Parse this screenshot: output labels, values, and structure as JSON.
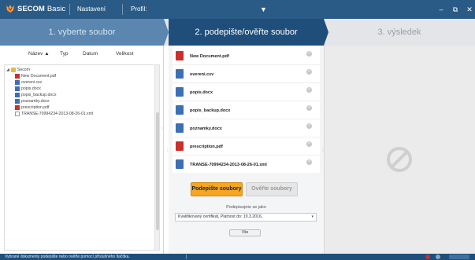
{
  "app": {
    "brand": "SECOM",
    "edition": "Basic",
    "menu": [
      "Nastavení",
      "Profil:"
    ],
    "window_buttons": [
      "–",
      "⧉",
      "✕"
    ]
  },
  "colors": {
    "titlebar": "#2a5b86",
    "step_inactive": "#5a86b0",
    "step_active": "#1f4e7b",
    "sign_button": "#f5a623"
  },
  "steps": [
    {
      "label": "1. vyberte soubor",
      "state": "done"
    },
    {
      "label": "2. podepište/ověřte soubor",
      "state": "active"
    },
    {
      "label": "3. výsledek",
      "state": "pending"
    }
  ],
  "browser": {
    "columns": [
      "Název ▲",
      "Typ",
      "Datum",
      "Velikost"
    ],
    "tree": [
      {
        "label": "Secom",
        "type": "folder",
        "depth": 0,
        "expanded": true
      },
      {
        "label": "New Document.pdf",
        "type": "pdf",
        "depth": 1
      },
      {
        "label": "overeni.csv",
        "type": "doc",
        "depth": 1
      },
      {
        "label": "popis.docx",
        "type": "doc",
        "depth": 1
      },
      {
        "label": "popis_backup.docx",
        "type": "doc",
        "depth": 1
      },
      {
        "label": "poznamky.docx",
        "type": "doc",
        "depth": 1
      },
      {
        "label": "prescription.pdf",
        "type": "pdf",
        "depth": 1
      },
      {
        "label": "TRANSE-70994234-2013-08-26-01.xml",
        "type": "xml",
        "depth": 1
      }
    ]
  },
  "selected_files": [
    {
      "name": "New Document.pdf",
      "type": "pdf"
    },
    {
      "name": "overeni.csv",
      "type": "doc"
    },
    {
      "name": "popis.docx",
      "type": "doc"
    },
    {
      "name": "popis_backup.docx",
      "type": "doc"
    },
    {
      "name": "poznamky.docx",
      "type": "doc"
    },
    {
      "name": "prescription.pdf",
      "type": "pdf"
    },
    {
      "name": "TRANSE-70994234-2013-08-26-01.xml",
      "type": "doc"
    }
  ],
  "actions": {
    "sign_label": "Podepište soubory",
    "verify_label": "Ověřte soubory",
    "sign_as_label": "Podepisujete se jako",
    "certificate_value": "Kvalifikovaný certifikát, Platnost do: 19.3.2016,",
    "all_label": "Vše"
  },
  "status": {
    "text": "Vybrané dokumenty podepište nebo ověřte pomocí příslušného tlačítka."
  }
}
